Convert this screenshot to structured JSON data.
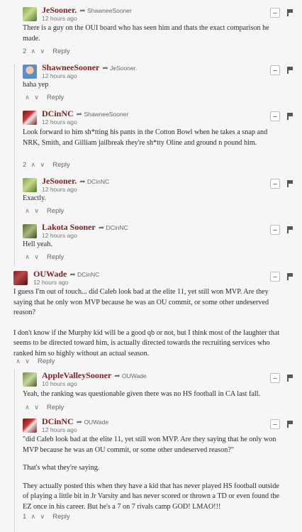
{
  "comments": [
    {
      "author": "JeSooner.",
      "reply_to": "ShawneeSooner",
      "time": "12 hours ago",
      "body": [
        "There is a guy on the OUI board who has seen him and thats the exact comparison he made."
      ],
      "votes": "2",
      "reply_label": "Reply",
      "avatar": "avatar-green"
    },
    {
      "author": "ShawneeSooner",
      "reply_to": "JeSooner.",
      "time": "12 hours ago",
      "body": [
        "haha yep"
      ],
      "votes": "",
      "reply_label": "Reply",
      "avatar": "avatar-person"
    },
    {
      "author": "DCinNC",
      "reply_to": "ShawneeSooner",
      "time": "12 hours ago",
      "body": [
        "Look forward to him sh*tting his pants in the Cotton Bowl when he takes a snap and NRK, Smith, and Gilliam jailbreak they're sh*tty Oline and ground n pound him."
      ],
      "votes": "2",
      "reply_label": "Reply",
      "avatar": "avatar-red"
    },
    {
      "author": "JeSooner.",
      "reply_to": "DCinNC",
      "time": "12 hours ago",
      "body": [
        "Exactly."
      ],
      "votes": "",
      "reply_label": "Reply",
      "avatar": "avatar-green"
    },
    {
      "author": "Lakota Sooner",
      "reply_to": "DCinNC",
      "time": "12 hours ago",
      "body": [
        "Hell yeah."
      ],
      "votes": "",
      "reply_label": "Reply",
      "avatar": "avatar-olive"
    },
    {
      "author": "OUWade",
      "reply_to": "DCinNC",
      "time": "12 hours ago",
      "body": [
        "I guess I'm out of touch... did Caleb look bad at the elite 11, yet still won MVP. Are they saying that he only won MVP because he was an OU commit, or some other undeserved reason?",
        "I don't know if the Murphy kid will be a good qb or not, but I think most of the laughter that seems to be directed toward him, is actually directed towards the recruiting services who ranked him so highly without an actual season."
      ],
      "votes": "",
      "reply_label": "Reply",
      "avatar": "avatar-maroon"
    },
    {
      "author": "AppleValleySooner",
      "reply_to": "OUWade",
      "time": "10 hours ago",
      "body": [
        "Yeah, the ranking was questionable given there was no HS football in CA last fall."
      ],
      "votes": "",
      "reply_label": "Reply",
      "avatar": "avatar-green2"
    },
    {
      "author": "DCinNC",
      "reply_to": "OUWade",
      "time": "12 hours ago",
      "body": [
        "\"did Caleb look bad at the elite 11, yet still won MVP. Are they saying that he only won MVP because he was an OU commit, or some other undeserved reason?\"",
        "That's what they're saying.",
        "They actually posted this when they have a kid that has never played HS football outside of playing a little bit in Jr Varsity and has never scored or thrown a TD or even found the EZ once in his career. But he's a 7 on 7 rivals camp GOD! LMAO!!!"
      ],
      "votes": "1",
      "reply_label": "Reply",
      "avatar": "avatar-red"
    }
  ]
}
